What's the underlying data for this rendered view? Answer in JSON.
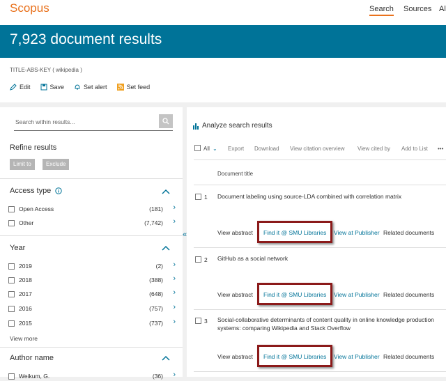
{
  "header": {
    "logo": "Scopus",
    "nav": [
      "Search",
      "Sources",
      "Al"
    ]
  },
  "hero": {
    "title": "7,923 document results"
  },
  "query": {
    "text": "TITLE-ABS-KEY ( wikipedia )",
    "actions": [
      "Edit",
      "Save",
      "Set alert",
      "Set feed"
    ]
  },
  "refine": {
    "search_placeholder": "Search within results...",
    "title": "Refine results",
    "limit_label": "Limit to",
    "exclude_label": "Exclude",
    "access_type": {
      "title": "Access type",
      "options": [
        {
          "label": "Open Access",
          "count": "(181)"
        },
        {
          "label": "Other",
          "count": "(7,742)"
        }
      ]
    },
    "year": {
      "title": "Year",
      "options": [
        {
          "label": "2019",
          "count": "(2)"
        },
        {
          "label": "2018",
          "count": "(388)"
        },
        {
          "label": "2017",
          "count": "(648)"
        },
        {
          "label": "2016",
          "count": "(757)"
        },
        {
          "label": "2015",
          "count": "(737)"
        }
      ],
      "view_more": "View more"
    },
    "author": {
      "title": "Author name",
      "options": [
        {
          "label": "Weikum, G.",
          "count": "(36)"
        }
      ]
    }
  },
  "results": {
    "analyze": "Analyze search results",
    "toolbar": {
      "all": "All",
      "export": "Export",
      "download": "Download",
      "citation": "View citation overview",
      "cited_by": "View cited by",
      "add_list": "Add to List",
      "more": "•••"
    },
    "column_title": "Document title",
    "rows": [
      {
        "num": "1",
        "title": "Document labeling using source-LDA combined with correlation matrix",
        "view_abstract": "View abstract",
        "find_it": "Find it @ SMU Libraries",
        "publisher": "View at Publisher",
        "related": "Related documents"
      },
      {
        "num": "2",
        "title": "GitHub as a social network",
        "view_abstract": "View abstract",
        "find_it": "Find it @ SMU Libraries",
        "publisher": "View at Publisher",
        "related": "Related documents"
      },
      {
        "num": "3",
        "title": "Social-collaborative determinants of content quality in online knowledge production systems: comparing Wikipedia and Stack Overflow",
        "view_abstract": "View abstract",
        "find_it": "Find it @ SMU Libraries",
        "publisher": "View at Publisher",
        "related": "Related documents"
      }
    ]
  },
  "colors": {
    "brand_orange": "#e9711c",
    "teal": "#007398",
    "highlight_box": "#8b1a1a"
  }
}
